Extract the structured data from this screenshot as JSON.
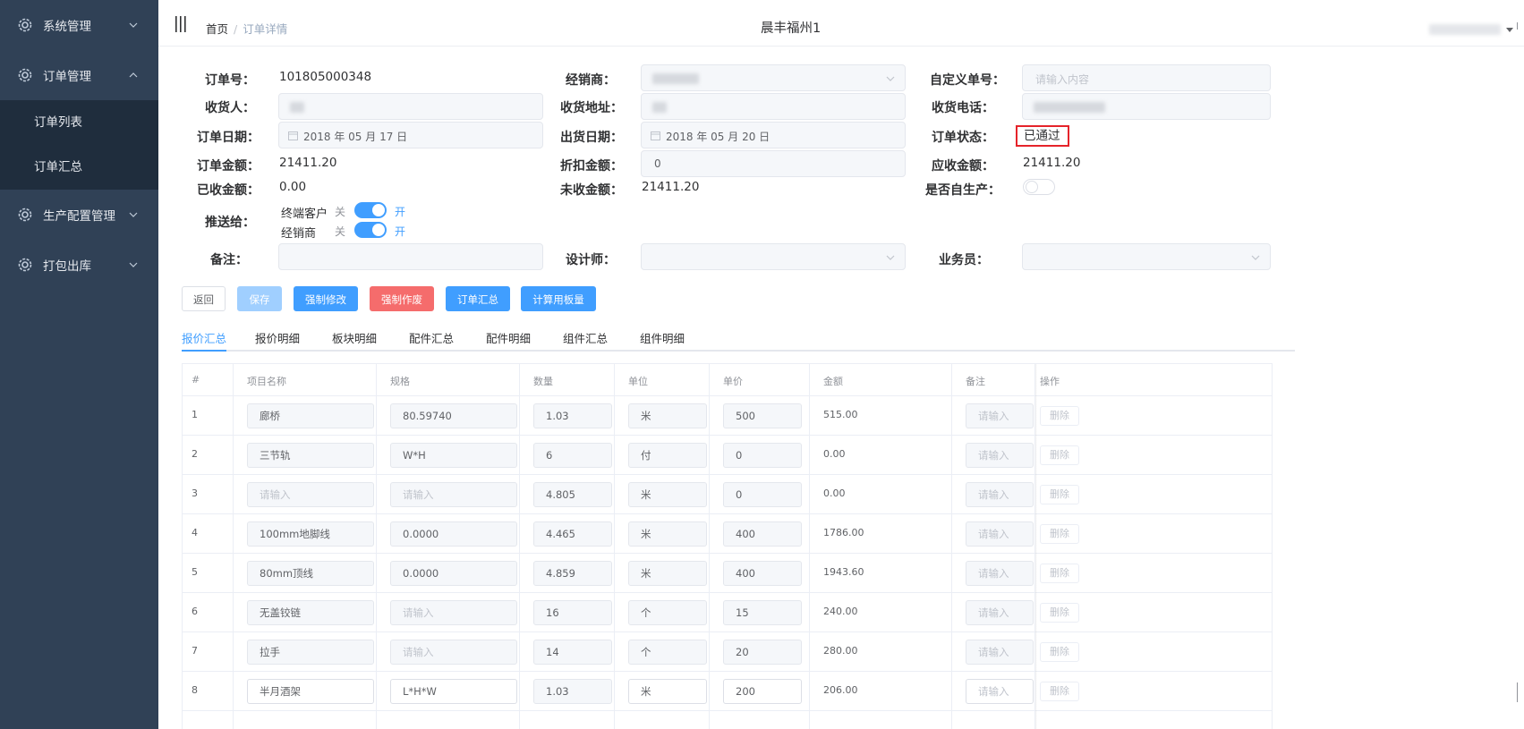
{
  "sidebar": {
    "items": [
      {
        "label": "系统管理",
        "expanded": false
      },
      {
        "label": "订单管理",
        "expanded": true,
        "children": [
          {
            "label": "订单列表"
          },
          {
            "label": "订单汇总"
          }
        ]
      },
      {
        "label": "生产配置管理",
        "expanded": false
      },
      {
        "label": "打包出库",
        "expanded": false
      }
    ]
  },
  "navbar": {
    "breadcrumb_home": "首页",
    "breadcrumb_sep": "/",
    "breadcrumb_current": "订单详情",
    "title": "晨丰福州1"
  },
  "form": {
    "order_no_label": "订单号：",
    "order_no": "101805000348",
    "dealer_label": "经销商：",
    "custom_no_label": "自定义单号：",
    "custom_no_placeholder": "请输入内容",
    "receiver_label": "收货人：",
    "address_label": "收货地址：",
    "phone_label": "收货电话：",
    "order_date_label": "订单日期：",
    "order_date": "2018 年 05 月 17 日",
    "ship_date_label": "出货日期：",
    "ship_date": "2018 年 05 月 20 日",
    "status_label": "订单状态：",
    "status": "已通过",
    "amount_label": "订单金额：",
    "amount": "21411.20",
    "discount_label": "折扣金额：",
    "discount": "0",
    "receivable_label": "应收金额：",
    "receivable": "21411.20",
    "received_label": "已收金额：",
    "received": "0.00",
    "unreceived_label": "未收金额：",
    "unreceived": "21411.20",
    "self_produce_label": "是否自生产：",
    "self_produce": false,
    "push_label": "推送给：",
    "push_customer_label": "终端客户",
    "push_dealer_label": "经销商",
    "switch_off": "关",
    "switch_on": "开",
    "push_customer": true,
    "push_dealer": true,
    "remark_label": "备注：",
    "designer_label": "设计师：",
    "salesman_label": "业务员："
  },
  "buttons": {
    "back": "返回",
    "save": "保存",
    "force_edit": "强制修改",
    "force_void": "强制作废",
    "order_summary": "订单汇总",
    "calc_board": "计算用板量"
  },
  "tabs": [
    "报价汇总",
    "报价明细",
    "板块明细",
    "配件汇总",
    "配件明细",
    "组件汇总",
    "组件明细"
  ],
  "active_tab": 0,
  "table": {
    "headers": [
      "#",
      "项目名称",
      "规格",
      "数量",
      "单位",
      "单价",
      "金额",
      "备注",
      "操作"
    ],
    "placeholder": "请输入",
    "delete_label": "删除",
    "rows": [
      {
        "no": "1",
        "name": "廊桥",
        "spec": "80.59740",
        "qty": "1.03",
        "unit": "米",
        "price": "500",
        "amount": "515.00"
      },
      {
        "no": "2",
        "name": "三节轨",
        "spec": "W*H",
        "qty": "6",
        "unit": "付",
        "price": "0",
        "amount": "0.00"
      },
      {
        "no": "3",
        "name": "",
        "spec": "",
        "qty": "4.805",
        "unit": "米",
        "price": "0",
        "amount": "0.00"
      },
      {
        "no": "4",
        "name": "100mm地脚线",
        "spec": "0.0000",
        "qty": "4.465",
        "unit": "米",
        "price": "400",
        "amount": "1786.00"
      },
      {
        "no": "5",
        "name": "80mm顶线",
        "spec": "0.0000",
        "qty": "4.859",
        "unit": "米",
        "price": "400",
        "amount": "1943.60"
      },
      {
        "no": "6",
        "name": "无盖铰链",
        "spec": "",
        "qty": "16",
        "unit": "个",
        "price": "15",
        "amount": "240.00"
      },
      {
        "no": "7",
        "name": "拉手",
        "spec": "",
        "qty": "14",
        "unit": "个",
        "price": "20",
        "amount": "280.00"
      },
      {
        "no": "8",
        "name": "半月酒架",
        "spec": "L*H*W",
        "qty": "1.03",
        "unit": "米",
        "price": "200",
        "amount": "206.00"
      }
    ]
  },
  "colors": {
    "sidebar_bg": "#304156",
    "submenu_bg": "#1f2d3d",
    "primary": "#409eff",
    "primary_light": "#a0cfff",
    "danger": "#f56c6c",
    "status_border": "#e5232a"
  }
}
